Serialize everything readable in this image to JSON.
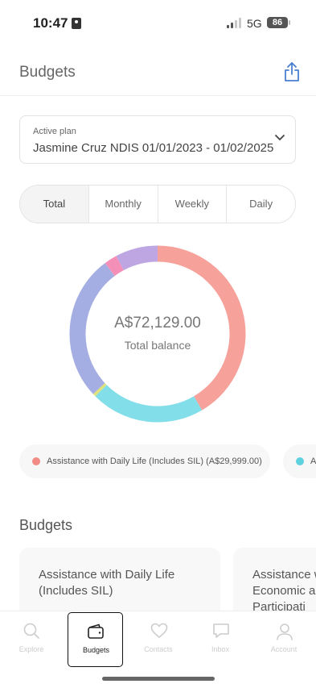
{
  "status": {
    "time": "10:47",
    "network": "5G",
    "battery": "86"
  },
  "header": {
    "title": "Budgets"
  },
  "plan": {
    "label": "Active plan",
    "value": "Jasmine Cruz NDIS 01/01/2023 - 01/02/2025"
  },
  "tabs": [
    "Total",
    "Monthly",
    "Weekly",
    "Daily"
  ],
  "chart": {
    "balance": "A$72,129.00",
    "balance_label": "Total balance"
  },
  "chart_data": {
    "type": "pie",
    "donut": true,
    "total": 72129.0,
    "slices": [
      {
        "label": "Assistance with Daily Life (Includes SIL)",
        "value": 29999.0,
        "color": "#f7a19b"
      },
      {
        "value": 15100,
        "color": "#82dfe9"
      },
      {
        "value": 400,
        "color": "#dfe27a"
      },
      {
        "value": 19300,
        "color": "#a5aee3"
      },
      {
        "value": 1700,
        "color": "#f48fb8"
      },
      {
        "value": 5630,
        "color": "#bea6e3"
      }
    ]
  },
  "legend": [
    {
      "label": "Assistance with Daily Life (Includes SIL) (A$29,999.00)",
      "color": "#f28b86"
    },
    {
      "label": "A",
      "color": "#5fd0dd"
    }
  ],
  "budgets_section": {
    "title": "Budgets",
    "cards": [
      {
        "title_line1": "Assistance with Daily Life",
        "title_line2": "(Includes SIL)"
      },
      {
        "title_line1": "Assistance w",
        "title_line2": "Economic a",
        "title_line3": "Participati"
      }
    ]
  },
  "tabbar": [
    {
      "label": "Explore",
      "icon": "search-icon"
    },
    {
      "label": "Budgets",
      "icon": "wallet-icon"
    },
    {
      "label": "Contacts",
      "icon": "heart-icon"
    },
    {
      "label": "Inbox",
      "icon": "chat-icon"
    },
    {
      "label": "Account",
      "icon": "person-icon"
    }
  ]
}
